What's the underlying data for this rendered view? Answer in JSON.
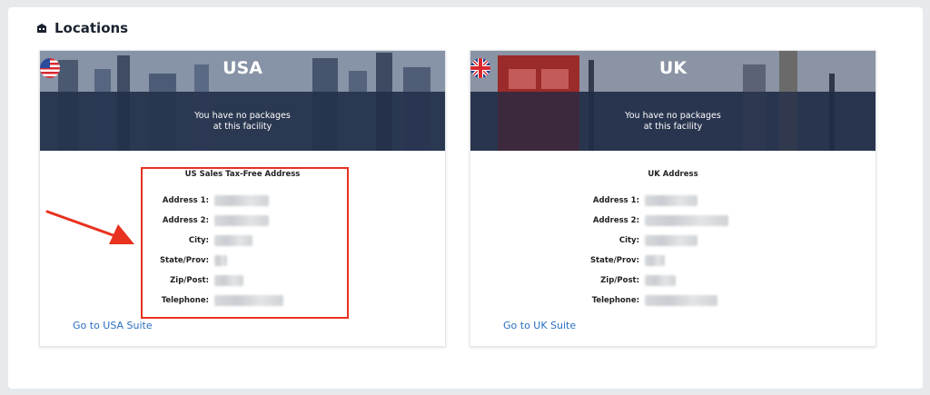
{
  "section": {
    "title": "Locations",
    "icon": "building-icon"
  },
  "cards": [
    {
      "country": "USA",
      "flag_icon": "us-flag-icon",
      "package_line1": "You have no packages",
      "package_line2": "at this facility",
      "address_title": "US Sales Tax-Free Address",
      "fields": [
        "Address 1:",
        "Address 2:",
        "City:",
        "State/Prov:",
        "Zip/Post:",
        "Telephone:"
      ],
      "link": "Go to USA Suite"
    },
    {
      "country": "UK",
      "flag_icon": "uk-flag-icon",
      "package_line1": "You have no packages",
      "package_line2": "at this facility",
      "address_title": "UK Address",
      "fields": [
        "Address 1:",
        "Address 2:",
        "City:",
        "State/Prov:",
        "Zip/Post:",
        "Telephone:"
      ],
      "link": "Go to UK Suite"
    }
  ],
  "colors": {
    "link": "#2a6fc1",
    "highlight": "#e8311f",
    "banner_overlay": "#1d2a44"
  }
}
